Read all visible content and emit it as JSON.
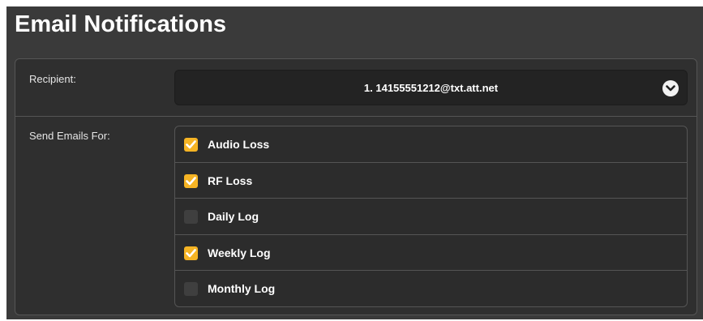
{
  "page": {
    "title": "Email Notifications"
  },
  "recipient": {
    "label": "Recipient:",
    "selected": "1. 14155551212@txt.att.net"
  },
  "send_emails": {
    "label": "Send Emails For:",
    "options": [
      {
        "label": "Audio Loss",
        "checked": true
      },
      {
        "label": "RF Loss",
        "checked": true
      },
      {
        "label": "Daily Log",
        "checked": false
      },
      {
        "label": "Weekly Log",
        "checked": true
      },
      {
        "label": "Monthly Log",
        "checked": false
      }
    ]
  },
  "colors": {
    "accent": "#f6b424",
    "panel_bg": "#3a3a3a",
    "card_bg": "#2f2f2f"
  },
  "icons": {
    "dropdown": "chevron-down-icon",
    "check": "checkmark-icon"
  }
}
